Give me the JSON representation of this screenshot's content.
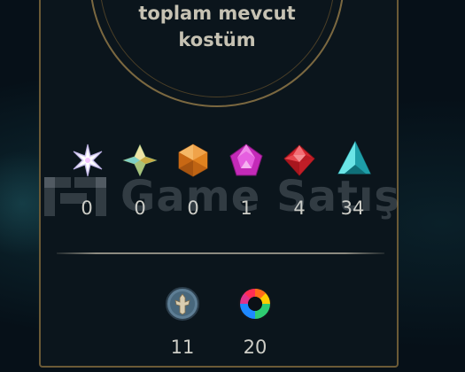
{
  "caption": {
    "line1": "toplam mevcut",
    "line2": "kostüm"
  },
  "gems": [
    {
      "icon": "white-star-gem-icon",
      "count": "0",
      "color": "#e6e0f5"
    },
    {
      "icon": "gold-diamond-gem-icon",
      "count": "0",
      "color": "#d8c66a"
    },
    {
      "icon": "orange-hexagon-gem-icon",
      "count": "0",
      "color": "#e7861e"
    },
    {
      "icon": "magenta-pentagon-gem-icon",
      "count": "1",
      "color": "#d436c8"
    },
    {
      "icon": "red-rhombus-gem-icon",
      "count": "4",
      "color": "#e2363f"
    },
    {
      "icon": "cyan-triangle-gem-icon",
      "count": "34",
      "color": "#35c9cf"
    }
  ],
  "bottom": [
    {
      "icon": "emblem-icon",
      "count": "11"
    },
    {
      "icon": "color-wheel-icon",
      "count": "20"
    }
  ],
  "watermark": {
    "text": "Game Satış"
  },
  "colors": {
    "frame": "#6b5a36",
    "panel": "#0b151c",
    "text": "#cdcdc6"
  }
}
